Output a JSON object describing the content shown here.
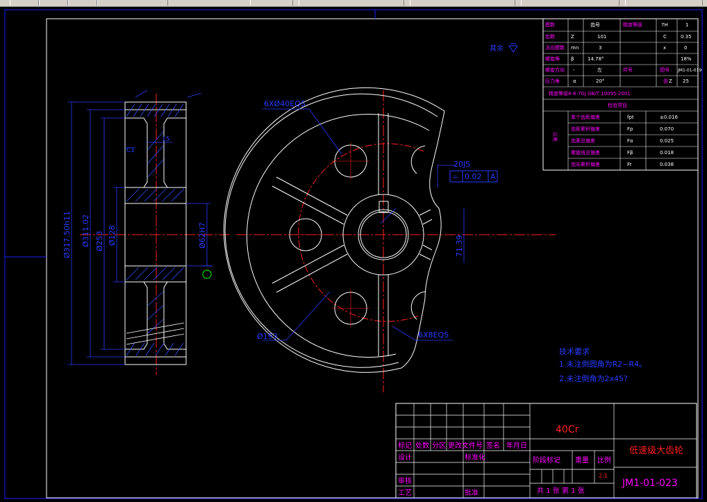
{
  "colors": {
    "frame": "#1e1eff",
    "white": "#ffffff",
    "center": "#ff2020",
    "dim": "#2a3cff",
    "magenta": "#ff00ff",
    "cyan": "#00c8c8",
    "green": "#00ff00",
    "yellow": "#ffff00",
    "hatch": "#3050ff"
  },
  "toolbar": {
    "icons": [
      "new-icon",
      "open-icon",
      "save-icon",
      "print-icon",
      "cut-icon",
      "copy-icon"
    ]
  },
  "section_view": {
    "dims": [
      "Ø317.50h11",
      "Ø311.02",
      "Ø253",
      "Ø128",
      "Ø62H7",
      "15",
      "C1"
    ]
  },
  "front_view": {
    "holes": "6XØ40EQS",
    "spokes": "6X8EQS",
    "pcd": "Ø193",
    "keyway_width": "20JS",
    "keyway_depth": "71.39",
    "tolerance_symbol": "⌯",
    "tolerance_value": "0.02",
    "datum": "A"
  },
  "roughness": {
    "label": "其余"
  },
  "tech_requirements": {
    "title": "技术要求",
    "items": [
      "1.未注倒圆角为R2~R4。",
      "2.未注倒角为2x45?"
    ]
  },
  "param_table": {
    "rows": [
      [
        "模数",
        "齿号",
        "",
        "精度等级",
        "7H",
        "1"
      ],
      [
        "齿数",
        "Z",
        "101",
        "",
        "C",
        "0.35"
      ],
      [
        "法向模数",
        "mn",
        "3",
        "",
        "x",
        "0"
      ],
      [
        "螺旋角",
        "β",
        "14.78°",
        "",
        "",
        "18%"
      ],
      [
        "螺旋方向",
        "-",
        "左",
        "件号",
        "图号",
        "JM1-01-019"
      ],
      [
        "压力角",
        "α",
        "20°",
        "",
        "齿",
        "Z",
        "25"
      ]
    ],
    "standard": "精度等级8-8-7GJ GB/T 10095-2001",
    "check_title": "检验项目",
    "side_label": "公差",
    "checks": [
      [
        "单个齿距偏差",
        "fpt",
        "±0.016"
      ],
      [
        "齿距累积偏差",
        "Fp",
        "0.070"
      ],
      [
        "齿廓总偏差",
        "Fα",
        "0.025"
      ],
      [
        "螺旋线总偏差",
        "Fβ",
        "0.018"
      ],
      [
        "齿向累积偏差",
        "Fr",
        "0.038"
      ]
    ]
  },
  "title_block": {
    "material": "40Cr",
    "part_name": "低速级大齿轮",
    "drawing_no": "JM1-01-023",
    "headers": [
      "标记",
      "处数",
      "分区",
      "更改文件号",
      "签名",
      "年月日"
    ],
    "design": "设计",
    "standardize": "标准化",
    "check": "审核",
    "process": "工艺",
    "approve": "批准",
    "stage": "阶段标记",
    "weight": "重量",
    "scale": "比例",
    "scale_value": "2:1",
    "sheets": "共 1 张  第 1 张"
  }
}
